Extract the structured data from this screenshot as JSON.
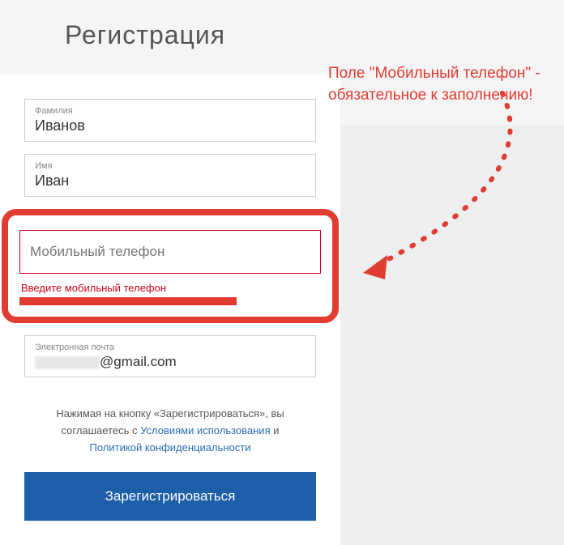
{
  "heading": "Регистрация",
  "annotation": "Поле \"Мобильный телефон\" - обязательное к заполнению!",
  "fields": {
    "surname": {
      "label": "Фамилия",
      "value": "Иванов"
    },
    "name": {
      "label": "Имя",
      "value": "Иван"
    },
    "phone": {
      "placeholder": "Мобильный телефон",
      "error": "Введите мобильный телефон"
    },
    "email": {
      "label": "Электронная почта",
      "value": "@gmail.com"
    }
  },
  "consent": {
    "prefix": "Нажимая на кнопку «Зарегистрироваться», вы соглашаетесь с ",
    "terms": "Условиями использования",
    "and": " и ",
    "privacy": "Политикой конфиденциальности"
  },
  "register": "Зарегистрироваться"
}
